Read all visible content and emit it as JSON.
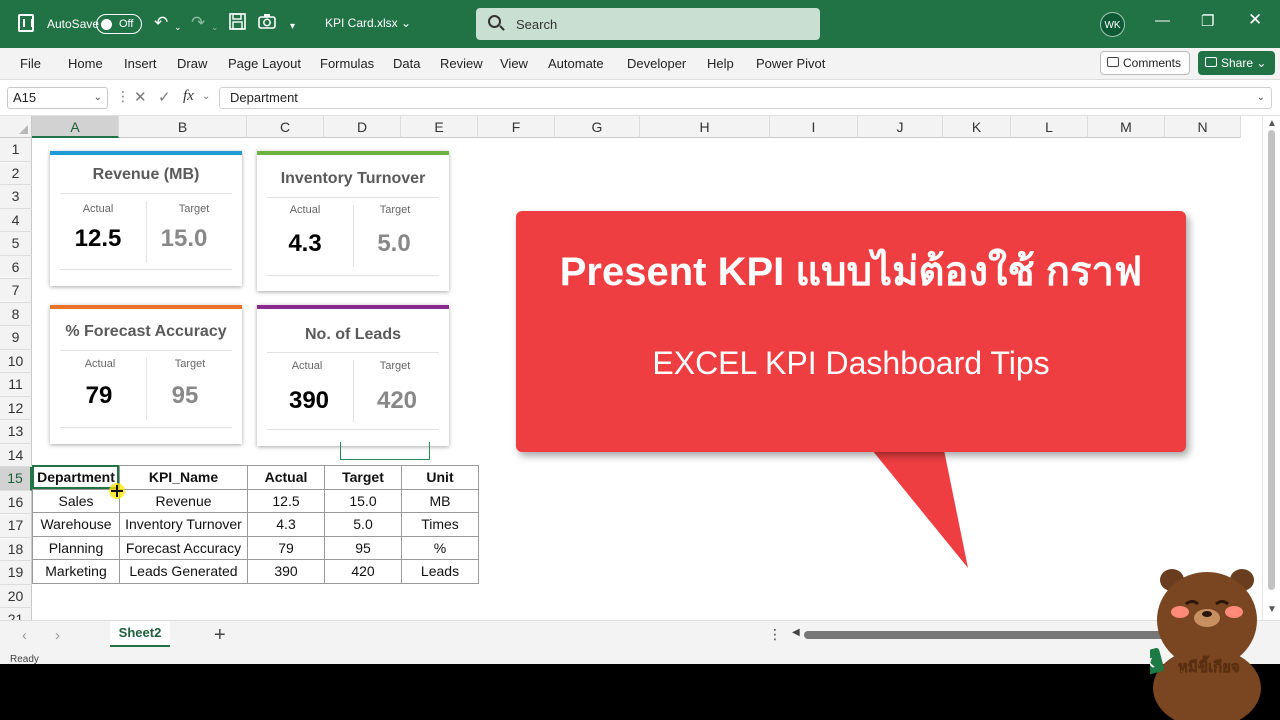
{
  "titlebar": {
    "autosave_label": "AutoSave",
    "autosave_state": "Off",
    "file_title": "KPI Card.xlsx",
    "search_placeholder": "Search",
    "avatar_initials": "WK"
  },
  "ribbon": {
    "tabs": [
      "File",
      "Home",
      "Insert",
      "Draw",
      "Page Layout",
      "Formulas",
      "Data",
      "Review",
      "View",
      "Automate",
      "Developer",
      "Help",
      "Power Pivot"
    ],
    "comments_label": "Comments",
    "share_label": "Share"
  },
  "formula_bar": {
    "name_box": "A15",
    "fx": "fx",
    "content": "Department"
  },
  "columns": [
    "A",
    "B",
    "C",
    "D",
    "E",
    "F",
    "G",
    "H",
    "I",
    "J",
    "K",
    "L",
    "M",
    "N"
  ],
  "rows": [
    "1",
    "2",
    "3",
    "4",
    "5",
    "6",
    "7",
    "8",
    "9",
    "10",
    "11",
    "12",
    "13",
    "14",
    "15",
    "16",
    "17",
    "18",
    "19",
    "20",
    "21"
  ],
  "kpi_cards": [
    {
      "title": "Revenue (MB)",
      "actual_label": "Actual",
      "target_label": "Target",
      "actual": "12.5",
      "target": "15.0",
      "color": "#1f9ad6"
    },
    {
      "title": "Inventory Turnover",
      "actual_label": "Actual",
      "target_label": "Target",
      "actual": "4.3",
      "target": "5.0",
      "color": "#6db33f"
    },
    {
      "title": "% Forecast Accuracy",
      "actual_label": "Actual",
      "target_label": "Target",
      "actual": "79",
      "target": "95",
      "color": "#e8742a"
    },
    {
      "title": "No. of Leads",
      "actual_label": "Actual",
      "target_label": "Target",
      "actual": "390",
      "target": "420",
      "color": "#8b2a8e"
    }
  ],
  "table": {
    "headers": [
      "Department",
      "KPI_Name",
      "Actual",
      "Target",
      "Unit"
    ],
    "rows": [
      [
        "Sales",
        "Revenue",
        "12.5",
        "15.0",
        "MB"
      ],
      [
        "Warehouse",
        "Inventory Turnover",
        "4.3",
        "5.0",
        "Times"
      ],
      [
        "Planning",
        "Forecast Accuracy",
        "79",
        "95",
        "%"
      ],
      [
        "Marketing",
        "Leads Generated",
        "390",
        "420",
        "Leads"
      ]
    ]
  },
  "callout": {
    "headline": "Present KPI แบบไม่ต้องใช้ กราฟ",
    "subline": "EXCEL KPI Dashboard Tips",
    "color": "#ef3e42"
  },
  "sheet_tabs": {
    "active": "Sheet2"
  },
  "status": {
    "ready": "Ready"
  },
  "mascot": {
    "caption": "หมีขี้เกียจ"
  }
}
